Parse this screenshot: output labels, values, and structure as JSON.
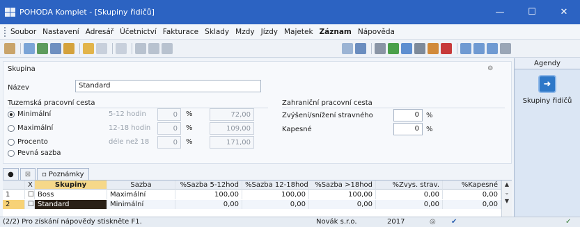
{
  "window": {
    "title": "POHODA Komplet - [Skupiny řidičů]",
    "min": "—",
    "max": "☐",
    "close": "✕"
  },
  "menu": [
    "Soubor",
    "Nastavení",
    "Adresář",
    "Účetnictví",
    "Fakturace",
    "Sklady",
    "Mzdy",
    "Jízdy",
    "Majetek",
    "Záznam",
    "Nápověda"
  ],
  "menu_bold": "Záznam",
  "form": {
    "section_title": "Skupina",
    "nazev_label": "Název",
    "nazev_value": "Standard",
    "domestic_title": "Tuzemská pracovní cesta",
    "options": [
      {
        "label": "Minimální",
        "range": "5-12 hodin",
        "pct": "0",
        "unit": "%",
        "amount": "72,00",
        "selected": true
      },
      {
        "label": "Maximální",
        "range": "12-18 hodin",
        "pct": "0",
        "unit": "%",
        "amount": "109,00",
        "selected": false
      },
      {
        "label": "Procento",
        "range": "déle než 18",
        "pct": "0",
        "unit": "%",
        "amount": "171,00",
        "selected": false
      },
      {
        "label": "Pevná sazba",
        "selected": false
      }
    ],
    "foreign_title": "Zahraniční pracovní cesta",
    "increase_label": "Zvýšení/snížení stravného",
    "increase_value": "0",
    "kapesne_label": "Kapesné",
    "kapesne_value": "0",
    "unit": "%"
  },
  "agendy": {
    "header": "Agendy",
    "item": "Skupiny řidičů"
  },
  "tabs": {
    "notes": "Poznámky"
  },
  "grid": {
    "headers": [
      "X",
      "Skupiny",
      "Sazba",
      "%Sazba 5-12hod",
      "%Sazba 12-18hod",
      "%Sazba >18hod",
      "%Zvys. strav.",
      "%Kapesné"
    ],
    "rows": [
      {
        "n": "1",
        "name": "Boss",
        "sazba": "Maximální",
        "a": "100,00",
        "b": "100,00",
        "c": "100,00",
        "d": "0,00",
        "e": "0,00"
      },
      {
        "n": "2",
        "name": "Standard",
        "sazba": "Minimální",
        "a": "0,00",
        "b": "0,00",
        "c": "0,00",
        "d": "0,00",
        "e": "0,00"
      }
    ]
  },
  "status": {
    "help": "(2/2) Pro získání nápovědy stiskněte F1.",
    "company": "Novák s.r.o.",
    "year": "2017"
  }
}
